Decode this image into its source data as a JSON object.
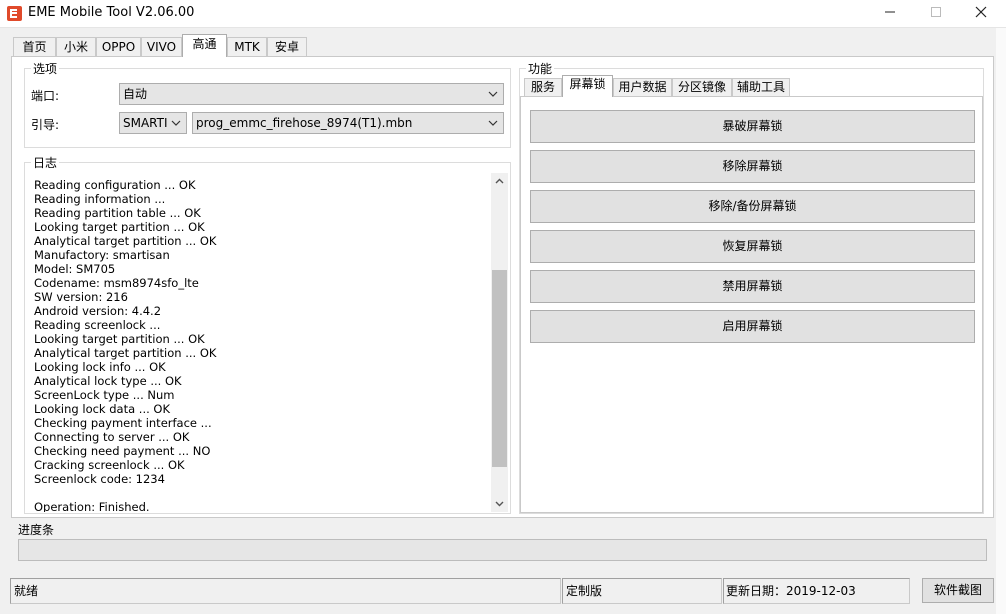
{
  "window": {
    "title": "EME Mobile Tool V2.06.00"
  },
  "main_tabs": [
    {
      "label": "首页"
    },
    {
      "label": "小米"
    },
    {
      "label": "OPPO"
    },
    {
      "label": "VIVO"
    },
    {
      "label": "高通"
    },
    {
      "label": "MTK"
    },
    {
      "label": "安卓"
    }
  ],
  "main_tab_active": "高通",
  "options": {
    "title": "选项",
    "port_label": "端口:",
    "port_value": "自动",
    "loader_label": "引导:",
    "loader_type_value": "SMARTI",
    "loader_file_value": "prog_emmc_firehose_8974(T1).mbn"
  },
  "log": {
    "title": "日志",
    "text": "Reading configuration ... OK\nReading information ...\nReading partition table ... OK\nLooking target partition ... OK\nAnalytical target partition ... OK\nManufactory: smartisan\nModel: SM705\nCodename: msm8974sfo_lte\nSW version: 216\nAndroid version: 4.4.2\nReading screenlock ...\nLooking target partition ... OK\nAnalytical target partition ... OK\nLooking lock info ... OK\nAnalytical lock type ... OK\nScreenLock type ... Num\nLooking lock data ... OK\nChecking payment interface ...\nConnecting to server ... OK\nChecking need payment ... NO\nCracking screenlock ... OK\nScreenlock code: 1234\n\nOperation: Finished."
  },
  "functions": {
    "title": "功能",
    "tabs": [
      {
        "label": "服务"
      },
      {
        "label": "屏幕锁"
      },
      {
        "label": "用户数据"
      },
      {
        "label": "分区镜像"
      },
      {
        "label": "辅助工具"
      }
    ],
    "active_tab": "屏幕锁",
    "buttons": [
      {
        "label": "暴破屏幕锁"
      },
      {
        "label": "移除屏幕锁"
      },
      {
        "label": "移除/备份屏幕锁"
      },
      {
        "label": "恢复屏幕锁"
      },
      {
        "label": "禁用屏幕锁"
      },
      {
        "label": "启用屏幕锁"
      }
    ]
  },
  "progress": {
    "title": "进度条",
    "fraction": 0
  },
  "status": {
    "state": "就绪",
    "edition": "定制版",
    "update_date": "更新日期：2019-12-03",
    "screenshot_button": "软件截图"
  },
  "colors": {
    "app_icon": "#e04a2b",
    "button_face": "#e1e1e1",
    "progress_fill": "#06b025"
  },
  "icons": {
    "app": "eme-logo-icon",
    "minimize": "minimize-icon",
    "maximize": "maximize-icon",
    "close": "close-icon",
    "dropdown": "chevron-down-icon",
    "scroll_up": "chevron-up-icon",
    "scroll_down": "chevron-down-icon"
  }
}
